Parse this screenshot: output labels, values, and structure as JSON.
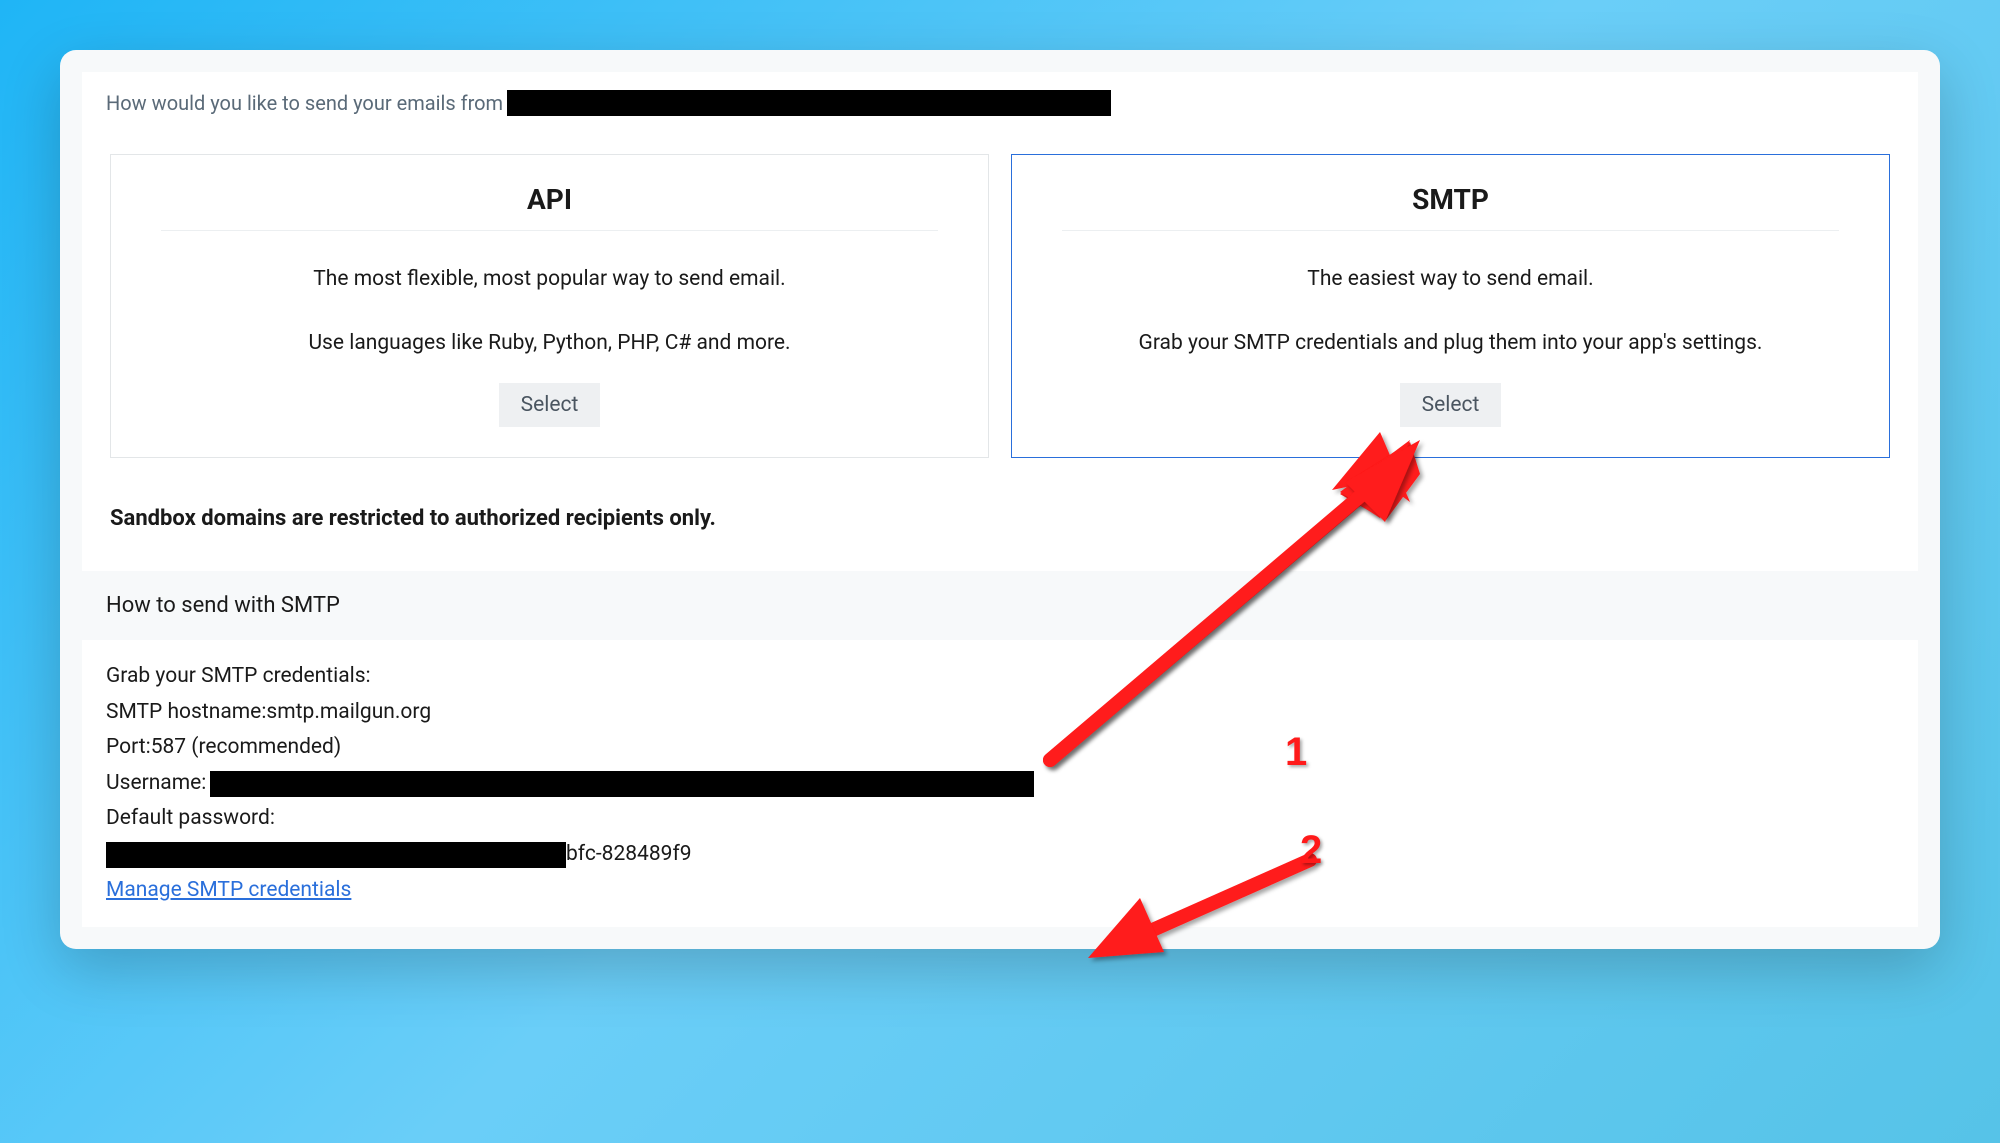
{
  "question": "How would you like to send your emails from",
  "options": {
    "api": {
      "title": "API",
      "desc1": "The most flexible, most popular way to send email.",
      "desc2": "Use languages like Ruby, Python, PHP, C# and more.",
      "button": "Select"
    },
    "smtp": {
      "title": "SMTP",
      "desc1": "The easiest way to send email.",
      "desc2": "Grab your SMTP credentials and plug them into your app's settings.",
      "button": "Select"
    }
  },
  "sandbox_note": "Sandbox domains are restricted to authorized recipients only.",
  "howto_heading": "How to send with SMTP",
  "creds": {
    "grab": "Grab your SMTP credentials:",
    "hostname_label": "SMTP hostname: ",
    "hostname_value": "smtp.mailgun.org",
    "port_label": "Port: ",
    "port_value": "587 (recommended)",
    "username_label": "Username:",
    "password_label": "Default password:",
    "password_suffix": "bfc-828489f9",
    "manage_link": "Manage SMTP credentials"
  },
  "annotations": {
    "num1": "1",
    "num2": "2"
  }
}
